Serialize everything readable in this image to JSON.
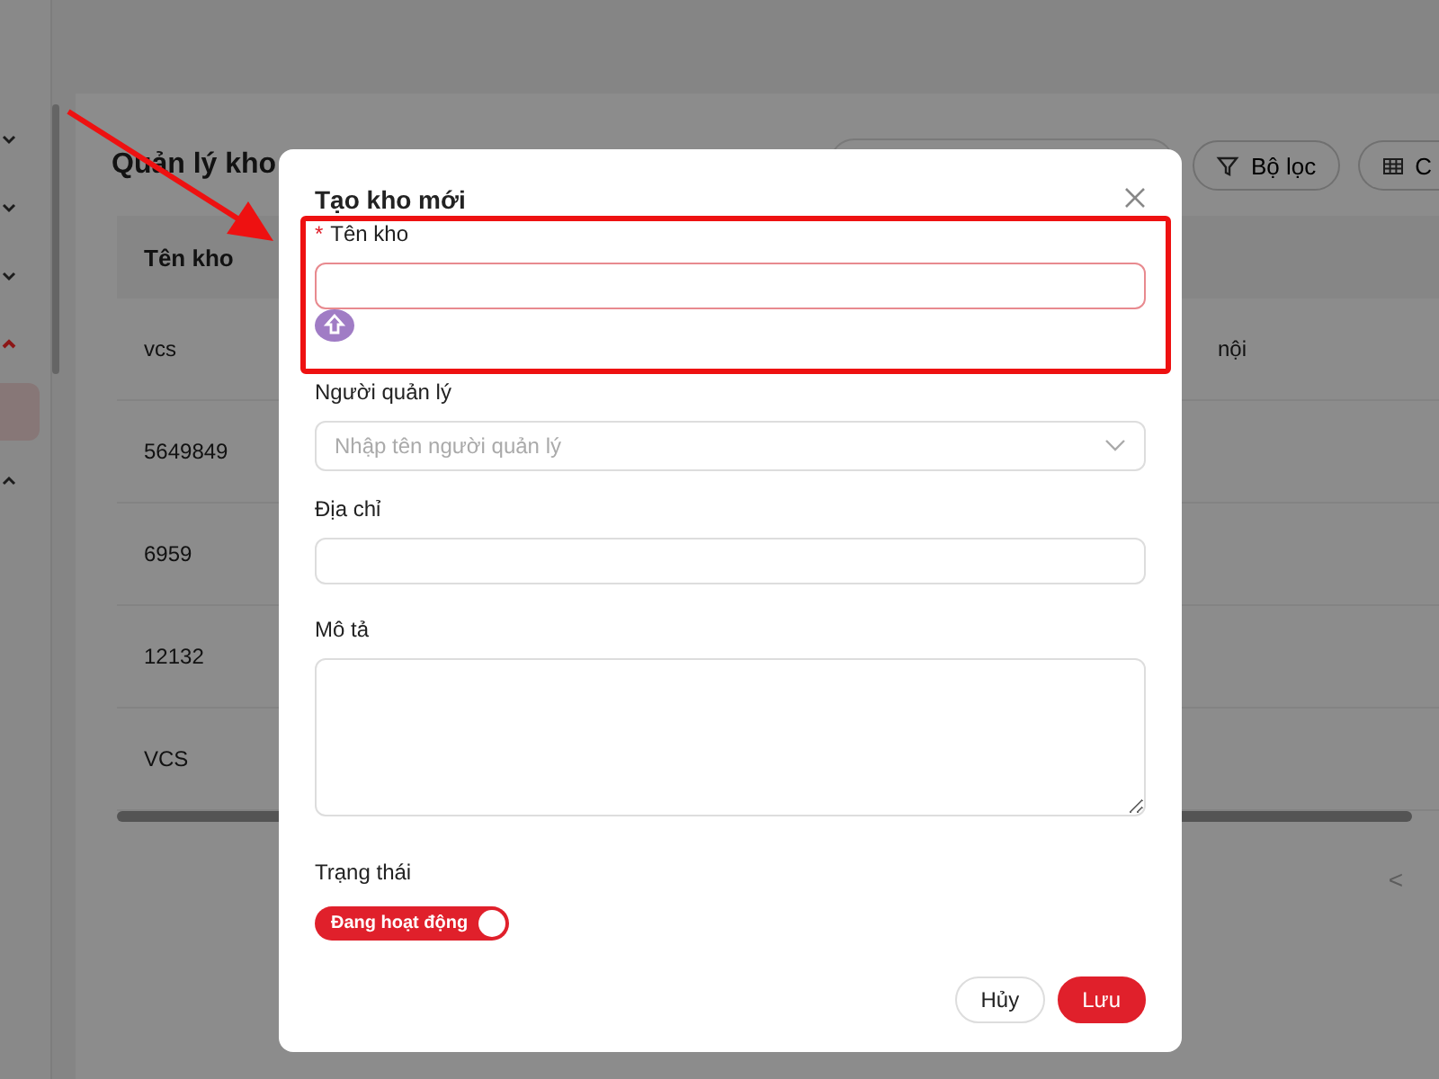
{
  "sidebar": {
    "items": [
      {
        "kind": "group",
        "expanded": false,
        "selected": false
      },
      {
        "kind": "group",
        "expanded": false,
        "selected": false
      },
      {
        "kind": "group",
        "expanded": false,
        "selected": false
      },
      {
        "kind": "group",
        "expanded": true,
        "selected": true
      },
      {
        "kind": "item",
        "selected": true
      },
      {
        "kind": "group",
        "expanded": true,
        "selected": false
      }
    ]
  },
  "page": {
    "title": "Quản lý kho",
    "toolbar": [
      {
        "label": "Bộ lọc"
      },
      {
        "label": "C"
      }
    ]
  },
  "table": {
    "columns": [
      "Tên kho"
    ],
    "rows": [
      {
        "name": "vcs",
        "column_2": "nội"
      },
      {
        "name": "5649849"
      },
      {
        "name": "6959"
      },
      {
        "name": "12132"
      },
      {
        "name": "VCS"
      }
    ]
  },
  "pagination": {
    "prev": "<"
  },
  "dialog": {
    "title": "Tạo kho mới",
    "fields": [
      {
        "kind": "input",
        "label": "Tên kho",
        "required_mark": "*",
        "invalid": true,
        "highlighted": true
      },
      {
        "kind": "select",
        "label": "Người quản lý",
        "placeholder": "Nhập tên người quản lý"
      },
      {
        "kind": "input",
        "label": "Địa chỉ"
      },
      {
        "kind": "textarea",
        "label": "Mô tả"
      }
    ],
    "status": {
      "label": "Trạng thái",
      "text": "Đang hoạt động",
      "on": true
    },
    "buttons": [
      {
        "label": "Hủy",
        "kind": "secondary"
      },
      {
        "label": "Lưu",
        "kind": "primary"
      }
    ]
  }
}
